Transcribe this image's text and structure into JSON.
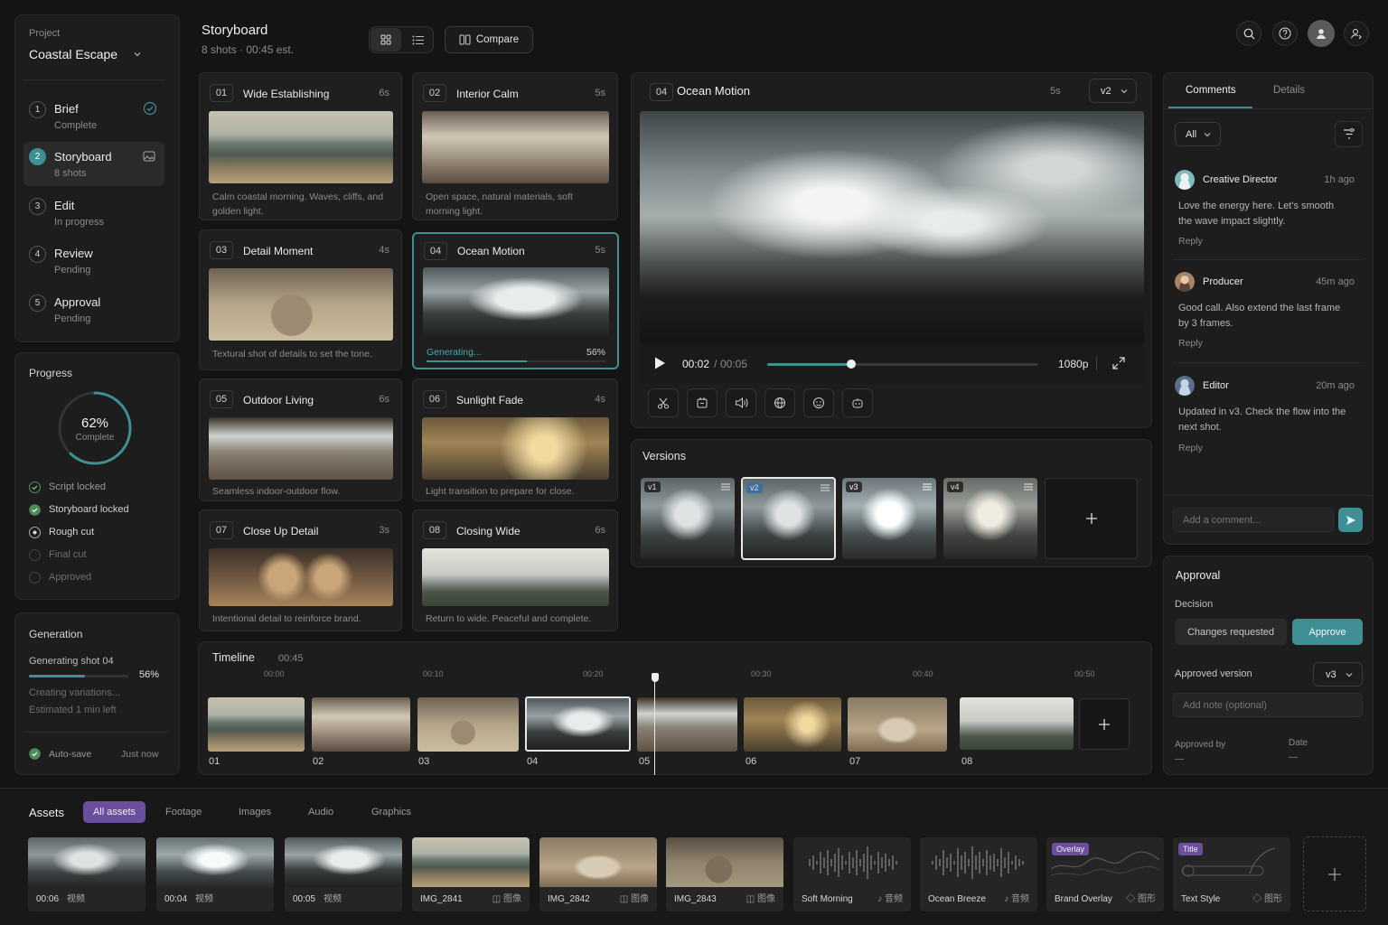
{
  "project": {
    "label": "Project",
    "name": "Coastal Escape"
  },
  "steps": [
    {
      "num": "1",
      "name": "Brief",
      "status": "Complete"
    },
    {
      "num": "2",
      "name": "Storyboard",
      "status": "8 shots"
    },
    {
      "num": "3",
      "name": "Edit",
      "status": "In progress"
    },
    {
      "num": "4",
      "name": "Review",
      "status": "Pending"
    },
    {
      "num": "5",
      "name": "Approval",
      "status": "Pending"
    }
  ],
  "progress": {
    "title": "Progress",
    "percent_label": "62%",
    "percent_value": 0.62,
    "sub": "Complete",
    "items": [
      "Script locked",
      "Storyboard locked",
      "Rough cut",
      "Final cut",
      "Approved"
    ]
  },
  "generation": {
    "title": "Generation",
    "label": "Generating shot 04",
    "percent": "56%",
    "value": 0.56,
    "line1": "Creating variations...",
    "line2": "Estimated 1 min left",
    "autosave": "Auto-save",
    "saved": "Just now"
  },
  "storyboard": {
    "title": "Storyboard",
    "subtitle": "8 shots · 00:45 est.",
    "compare": "Compare",
    "shots": [
      {
        "num": "01",
        "title": "Wide Establishing",
        "dur": "6s",
        "desc": "Calm coastal morning. Waves, cliffs, and golden light."
      },
      {
        "num": "02",
        "title": "Interior Calm",
        "dur": "5s",
        "desc": "Open space, natural materials, soft morning light."
      },
      {
        "num": "03",
        "title": "Detail Moment",
        "dur": "4s",
        "desc": "Textural shot of details to set the tone."
      },
      {
        "num": "04",
        "title": "Ocean Motion",
        "dur": "5s",
        "desc": "Generating...",
        "progress": "56%"
      },
      {
        "num": "05",
        "title": "Outdoor Living",
        "dur": "6s",
        "desc": "Seamless indoor-outdoor flow."
      },
      {
        "num": "06",
        "title": "Sunlight Fade",
        "dur": "4s",
        "desc": "Light transition to prepare for close."
      },
      {
        "num": "07",
        "title": "Close Up Detail",
        "dur": "3s",
        "desc": "Intentional detail to reinforce brand."
      },
      {
        "num": "08",
        "title": "Closing Wide",
        "dur": "6s",
        "desc": "Return to wide. Peaceful and complete."
      }
    ]
  },
  "viewer": {
    "num": "04",
    "title": "Ocean Motion",
    "dur": "5s",
    "version": "v2",
    "time_current": "00:02",
    "time_sep": "/",
    "time_total": "00:05",
    "playhead": 0.31,
    "quality": "1080p"
  },
  "versions": {
    "title": "Versions",
    "items": [
      "v1",
      "v2",
      "v3",
      "v4"
    ]
  },
  "timeline": {
    "title": "Timeline",
    "duration": "00:45",
    "ticks": [
      "00:00",
      "00:10",
      "00:20",
      "00:30",
      "00:40",
      "00:50"
    ],
    "clips": [
      "01",
      "02",
      "03",
      "04",
      "05",
      "06",
      "07",
      "08"
    ]
  },
  "comments": {
    "tab_comments": "Comments",
    "tab_details": "Details",
    "filter": "All",
    "items": [
      {
        "name": "Creative Director",
        "time": "1h ago",
        "text": "Love the energy here. Let's smooth the wave impact slightly.",
        "reply": "Reply"
      },
      {
        "name": "Producer",
        "time": "45m ago",
        "text": "Good call. Also extend the last frame by 3 frames.",
        "reply": "Reply"
      },
      {
        "name": "Editor",
        "time": "20m ago",
        "text": "Updated in v3. Check the flow into the next shot.",
        "reply": "Reply"
      }
    ],
    "placeholder": "Add a comment..."
  },
  "approval": {
    "title": "Approval",
    "decision": "Decision",
    "changes": "Changes requested",
    "approve": "Approve",
    "version_label": "Approved version",
    "version": "v3",
    "note_placeholder": "Add note (optional)",
    "approved_by": "Approved by",
    "approved_by_value": "—",
    "date": "Date",
    "date_value": "—"
  },
  "assets": {
    "title": "Assets",
    "tabs": [
      "All assets",
      "Footage",
      "Images",
      "Audio",
      "Graphics"
    ],
    "items": [
      {
        "label": "00:06",
        "type": "视频"
      },
      {
        "label": "00:04",
        "type": "视频"
      },
      {
        "label": "00:05",
        "type": "视频"
      },
      {
        "label": "IMG_2841",
        "type": "图像"
      },
      {
        "label": "IMG_2842",
        "type": "图像"
      },
      {
        "label": "IMG_2843",
        "type": "图像"
      },
      {
        "label": "Soft Morning",
        "type": "音频"
      },
      {
        "label": "Ocean Breeze",
        "type": "音频"
      },
      {
        "label": "Brand Overlay",
        "type": "图形",
        "badge": "Overlay"
      },
      {
        "label": "Text Style",
        "type": "图形",
        "badge": "Title"
      }
    ]
  },
  "colors": {
    "accent": "#3f8f95",
    "purple": "#6b4f9c"
  }
}
